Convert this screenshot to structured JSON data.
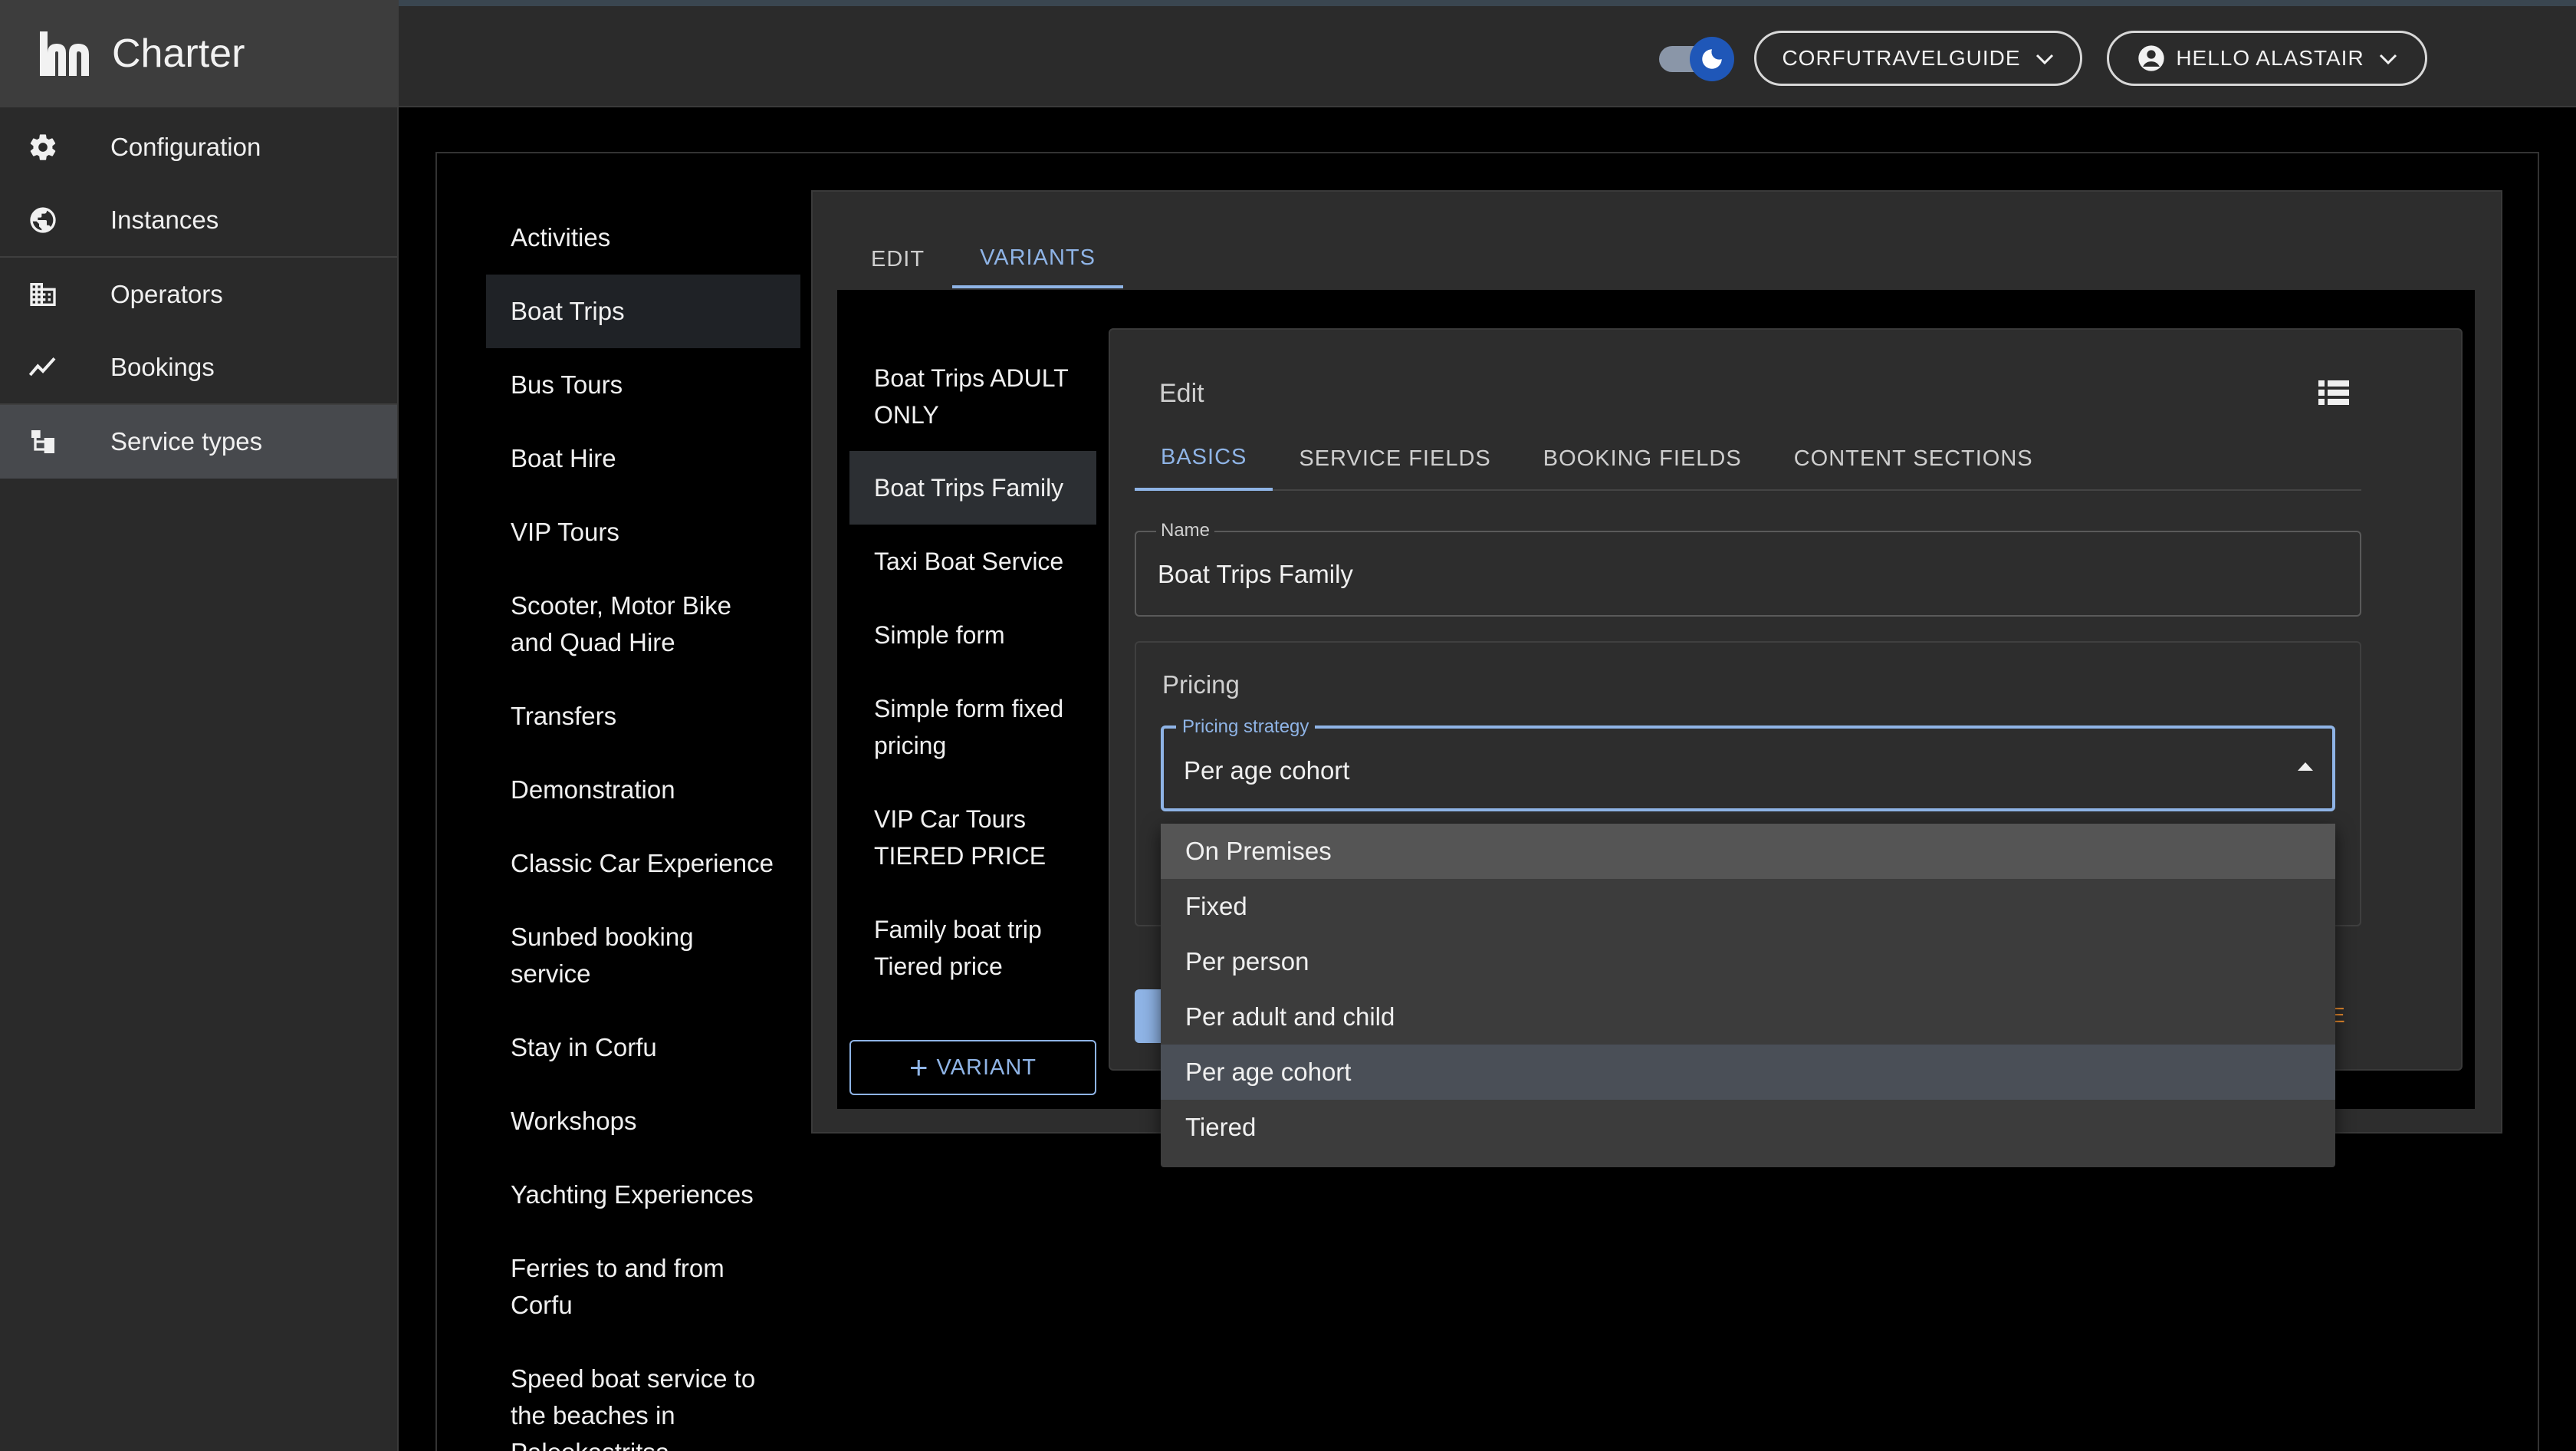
{
  "app": {
    "name": "Charter"
  },
  "sidebar": {
    "items": [
      {
        "label": "Configuration",
        "icon": "gear-icon"
      },
      {
        "label": "Instances",
        "icon": "globe-icon"
      },
      {
        "label": "Operators",
        "icon": "building-icon"
      },
      {
        "label": "Bookings",
        "icon": "trend-icon"
      },
      {
        "label": "Service types",
        "icon": "tree-icon",
        "active": true
      }
    ]
  },
  "header": {
    "theme_toggle": "dark-mode-toggle",
    "org_button": "CORFUTRAVELGUIDE",
    "user_button": "HELLO ALASTAIR"
  },
  "service_types": [
    "Activities",
    "Boat Trips",
    "Bus Tours",
    "Boat Hire",
    "VIP Tours",
    "Scooter, Motor Bike and Quad Hire",
    "Transfers",
    "Demonstration",
    "Classic Car Experience",
    "Sunbed booking service",
    "Stay in Corfu",
    "Workshops",
    "Yachting Experiences",
    "Ferries to and from Corfu",
    "Speed boat service to the beaches in Paleokastritsa"
  ],
  "service_tabs": [
    "EDIT",
    "VARIANTS"
  ],
  "variants": [
    "Boat Trips ADULT ONLY",
    "Boat Trips Family",
    "Taxi Boat Service",
    "Simple form",
    "Simple form fixed pricing",
    "VIP Car Tours TIERED PRICE",
    "Family boat trip Tiered price"
  ],
  "add_variant_label": "VARIANT",
  "edit": {
    "title": "Edit",
    "tabs": [
      "BASICS",
      "SERVICE FIELDS",
      "BOOKING FIELDS",
      "CONTENT SECTIONS"
    ],
    "name_label": "Name",
    "name_value": "Boat Trips Family",
    "pricing_title": "Pricing",
    "pricing_label": "Pricing strategy",
    "pricing_value": "Per age cohort",
    "delete_stub": "E"
  },
  "pricing_options": [
    "On Premises",
    "Fixed",
    "Per person",
    "Per adult and child",
    "Per age cohort",
    "Tiered"
  ],
  "colors": {
    "accent": "#8fb4e6",
    "warning": "#e68a2e",
    "toggle": "#1f57b8"
  }
}
